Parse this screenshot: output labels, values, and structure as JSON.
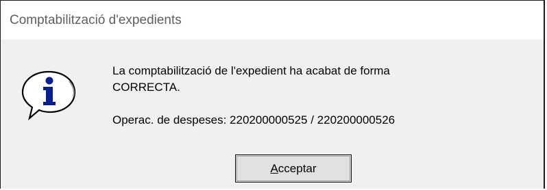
{
  "window": {
    "title": "Comptabilització d'expedients"
  },
  "message": {
    "line1": "La comptabilització de l'expedient ha acabat de forma",
    "line2": "CORRECTA.",
    "line3": "Operac. de despeses: 220200000525 / 220200000526"
  },
  "icon": {
    "name": "info-icon",
    "glyph": "i",
    "color": "#0a1f8f"
  },
  "button": {
    "mnemonic": "A",
    "rest": "cceptar"
  }
}
